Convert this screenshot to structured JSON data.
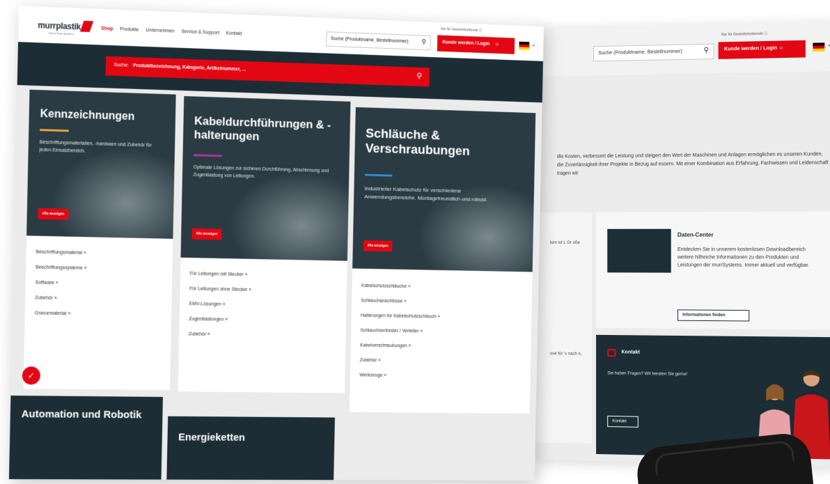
{
  "header": {
    "logo_text": "murrplastik",
    "logo_sub": "Great Than Systems",
    "nav": [
      "Shop",
      "Produkte",
      "Unternehmen",
      "Service & Support",
      "Kontakt"
    ],
    "search_placeholder": "Suche (Produktname, Bestellnummer)",
    "trade_note": "Nur für Gewerbetreibende ⓘ",
    "login_label": "Kunde werden / Login",
    "flag_colors": [
      "#000000",
      "#dd0000",
      "#ffce00"
    ]
  },
  "search_band": {
    "label": "Suche:",
    "placeholder": "Produktbezeichnung, Kategorie, Artikelnummer, ..."
  },
  "cards": [
    {
      "title": "Kennzeichnungen",
      "bar_color": "#e8a33a",
      "description": "Beschriftungsmaterialien, -hardware und Zubehör für jeden Einsatzbereich.",
      "button": "Alle anzeigen",
      "links": [
        "Beschriftungsmaterial »",
        "Beschriftungssysteme »",
        "Software »",
        "Zubehör »",
        "Gravurmaterial »"
      ]
    },
    {
      "title": "Kabeldurchführungen & -halterungen",
      "bar_color": "#a4399b",
      "description": "Optimale Lösungen zur sicheren Durchführung, Abschirmung und Zugentlastung von Leitungen.",
      "button": "Alle anzeigen",
      "links": [
        "Für Leitungen mit Stecker »",
        "Für Leitungen ohne Stecker »",
        "EMV-Lösungen »",
        "Zugentlastungen »",
        "Zubehör »"
      ]
    },
    {
      "title": "Schläuche & Verschraubungen",
      "bar_color": "#2b8fd6",
      "description": "Industrieller Kabelschutz für verschiedene Anwendungsbereiche. Montagefreundlich und robust.",
      "button": "Alle anzeigen",
      "links": [
        "Kabelschutzschläuche »",
        "Schlauchanschlüsse »",
        "Halterungen für Kabelschutzschlauch »",
        "Schlauchverbinder / Verteiler »",
        "Kabelverschraubungen »",
        "Zubehör »",
        "Werkzeuge »"
      ]
    }
  ],
  "bottom_cards": [
    "Automation und Robotik",
    "Energieketten"
  ],
  "back": {
    "search_placeholder": "Suche (Produktname, Bestellnummer)",
    "trade_note": "Nur für Gewerbetreibende ⓘ",
    "login_label": "Kunde werden / Login",
    "intro_text": "die Kosten, verbessert die Leistung und steigert den Wert der Maschinen und Anlagen ermöglichen es unseren Kunden, die Zuverlässigkeit ihrer Projekte in Bezug auf essern. Mit einer Kombination aus Erfahrung, Fachwissen und Leidenschaft tragen wir",
    "left_snippet_1": "tem ist t. Gr oße",
    "left_snippet_2": "ose für 's nach n.",
    "datacenter": {
      "title": "Daten-Center",
      "text": "Entdecken Sie in unserem kostenlosen Downloadbereich weitere hilfreiche Informationen zu den Produkten und Leistungen der murrSystems. Immer aktuell und verfügbar.",
      "button": "Informationen finden"
    },
    "contact": {
      "title": "Kontakt",
      "text": "Sie haben Fragen? Wir beraten Sie gerne!",
      "button": "Kontakt"
    }
  }
}
